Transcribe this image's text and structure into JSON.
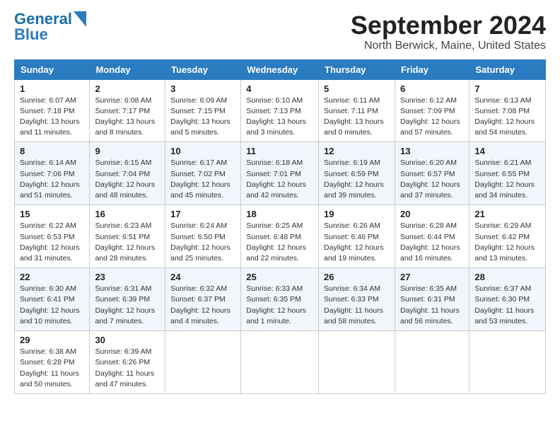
{
  "header": {
    "logo_line1": "General",
    "logo_line2": "Blue",
    "month": "September 2024",
    "location": "North Berwick, Maine, United States"
  },
  "weekdays": [
    "Sunday",
    "Monday",
    "Tuesday",
    "Wednesday",
    "Thursday",
    "Friday",
    "Saturday"
  ],
  "weeks": [
    [
      {
        "day": "1",
        "sunrise": "Sunrise: 6:07 AM",
        "sunset": "Sunset: 7:18 PM",
        "daylight": "Daylight: 13 hours and 11 minutes."
      },
      {
        "day": "2",
        "sunrise": "Sunrise: 6:08 AM",
        "sunset": "Sunset: 7:17 PM",
        "daylight": "Daylight: 13 hours and 8 minutes."
      },
      {
        "day": "3",
        "sunrise": "Sunrise: 6:09 AM",
        "sunset": "Sunset: 7:15 PM",
        "daylight": "Daylight: 13 hours and 5 minutes."
      },
      {
        "day": "4",
        "sunrise": "Sunrise: 6:10 AM",
        "sunset": "Sunset: 7:13 PM",
        "daylight": "Daylight: 13 hours and 3 minutes."
      },
      {
        "day": "5",
        "sunrise": "Sunrise: 6:11 AM",
        "sunset": "Sunset: 7:11 PM",
        "daylight": "Daylight: 13 hours and 0 minutes."
      },
      {
        "day": "6",
        "sunrise": "Sunrise: 6:12 AM",
        "sunset": "Sunset: 7:09 PM",
        "daylight": "Daylight: 12 hours and 57 minutes."
      },
      {
        "day": "7",
        "sunrise": "Sunrise: 6:13 AM",
        "sunset": "Sunset: 7:08 PM",
        "daylight": "Daylight: 12 hours and 54 minutes."
      }
    ],
    [
      {
        "day": "8",
        "sunrise": "Sunrise: 6:14 AM",
        "sunset": "Sunset: 7:06 PM",
        "daylight": "Daylight: 12 hours and 51 minutes."
      },
      {
        "day": "9",
        "sunrise": "Sunrise: 6:15 AM",
        "sunset": "Sunset: 7:04 PM",
        "daylight": "Daylight: 12 hours and 48 minutes."
      },
      {
        "day": "10",
        "sunrise": "Sunrise: 6:17 AM",
        "sunset": "Sunset: 7:02 PM",
        "daylight": "Daylight: 12 hours and 45 minutes."
      },
      {
        "day": "11",
        "sunrise": "Sunrise: 6:18 AM",
        "sunset": "Sunset: 7:01 PM",
        "daylight": "Daylight: 12 hours and 42 minutes."
      },
      {
        "day": "12",
        "sunrise": "Sunrise: 6:19 AM",
        "sunset": "Sunset: 6:59 PM",
        "daylight": "Daylight: 12 hours and 39 minutes."
      },
      {
        "day": "13",
        "sunrise": "Sunrise: 6:20 AM",
        "sunset": "Sunset: 6:57 PM",
        "daylight": "Daylight: 12 hours and 37 minutes."
      },
      {
        "day": "14",
        "sunrise": "Sunrise: 6:21 AM",
        "sunset": "Sunset: 6:55 PM",
        "daylight": "Daylight: 12 hours and 34 minutes."
      }
    ],
    [
      {
        "day": "15",
        "sunrise": "Sunrise: 6:22 AM",
        "sunset": "Sunset: 6:53 PM",
        "daylight": "Daylight: 12 hours and 31 minutes."
      },
      {
        "day": "16",
        "sunrise": "Sunrise: 6:23 AM",
        "sunset": "Sunset: 6:51 PM",
        "daylight": "Daylight: 12 hours and 28 minutes."
      },
      {
        "day": "17",
        "sunrise": "Sunrise: 6:24 AM",
        "sunset": "Sunset: 6:50 PM",
        "daylight": "Daylight: 12 hours and 25 minutes."
      },
      {
        "day": "18",
        "sunrise": "Sunrise: 6:25 AM",
        "sunset": "Sunset: 6:48 PM",
        "daylight": "Daylight: 12 hours and 22 minutes."
      },
      {
        "day": "19",
        "sunrise": "Sunrise: 6:26 AM",
        "sunset": "Sunset: 6:46 PM",
        "daylight": "Daylight: 12 hours and 19 minutes."
      },
      {
        "day": "20",
        "sunrise": "Sunrise: 6:28 AM",
        "sunset": "Sunset: 6:44 PM",
        "daylight": "Daylight: 12 hours and 16 minutes."
      },
      {
        "day": "21",
        "sunrise": "Sunrise: 6:29 AM",
        "sunset": "Sunset: 6:42 PM",
        "daylight": "Daylight: 12 hours and 13 minutes."
      }
    ],
    [
      {
        "day": "22",
        "sunrise": "Sunrise: 6:30 AM",
        "sunset": "Sunset: 6:41 PM",
        "daylight": "Daylight: 12 hours and 10 minutes."
      },
      {
        "day": "23",
        "sunrise": "Sunrise: 6:31 AM",
        "sunset": "Sunset: 6:39 PM",
        "daylight": "Daylight: 12 hours and 7 minutes."
      },
      {
        "day": "24",
        "sunrise": "Sunrise: 6:32 AM",
        "sunset": "Sunset: 6:37 PM",
        "daylight": "Daylight: 12 hours and 4 minutes."
      },
      {
        "day": "25",
        "sunrise": "Sunrise: 6:33 AM",
        "sunset": "Sunset: 6:35 PM",
        "daylight": "Daylight: 12 hours and 1 minute."
      },
      {
        "day": "26",
        "sunrise": "Sunrise: 6:34 AM",
        "sunset": "Sunset: 6:33 PM",
        "daylight": "Daylight: 11 hours and 58 minutes."
      },
      {
        "day": "27",
        "sunrise": "Sunrise: 6:35 AM",
        "sunset": "Sunset: 6:31 PM",
        "daylight": "Daylight: 11 hours and 56 minutes."
      },
      {
        "day": "28",
        "sunrise": "Sunrise: 6:37 AM",
        "sunset": "Sunset: 6:30 PM",
        "daylight": "Daylight: 11 hours and 53 minutes."
      }
    ],
    [
      {
        "day": "29",
        "sunrise": "Sunrise: 6:38 AM",
        "sunset": "Sunset: 6:28 PM",
        "daylight": "Daylight: 11 hours and 50 minutes."
      },
      {
        "day": "30",
        "sunrise": "Sunrise: 6:39 AM",
        "sunset": "Sunset: 6:26 PM",
        "daylight": "Daylight: 11 hours and 47 minutes."
      },
      null,
      null,
      null,
      null,
      null
    ]
  ]
}
